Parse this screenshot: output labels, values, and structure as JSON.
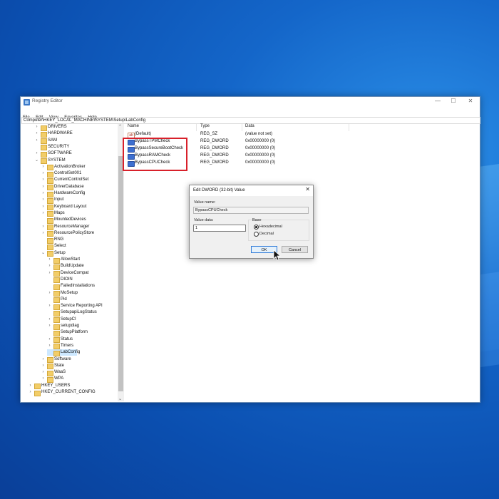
{
  "window": {
    "title": "Registry Editor",
    "controls": {
      "minimize": "—",
      "maximize": "☐",
      "close": "✕"
    }
  },
  "menu": [
    "File",
    "Edit",
    "View",
    "Favorites",
    "Help"
  ],
  "address": "Computer\\HKEY_LOCAL_MACHINE\\SYSTEM\\Setup\\LabConfig",
  "tree": {
    "items": [
      {
        "label": "DRIVERS",
        "depth": 1,
        "expander": "›"
      },
      {
        "label": "HARDWARE",
        "depth": 1,
        "expander": "›"
      },
      {
        "label": "SAM",
        "depth": 1,
        "expander": "›"
      },
      {
        "label": "SECURITY",
        "depth": 1,
        "expander": ""
      },
      {
        "label": "SOFTWARE",
        "depth": 1,
        "expander": "›"
      },
      {
        "label": "SYSTEM",
        "depth": 1,
        "expander": "⌄"
      },
      {
        "label": "ActivationBroker",
        "depth": 2,
        "expander": "›"
      },
      {
        "label": "ControlSet001",
        "depth": 2,
        "expander": "›"
      },
      {
        "label": "CurrentControlSet",
        "depth": 2,
        "expander": "›"
      },
      {
        "label": "DriverDatabase",
        "depth": 2,
        "expander": "›"
      },
      {
        "label": "HardwareConfig",
        "depth": 2,
        "expander": "›"
      },
      {
        "label": "Input",
        "depth": 2,
        "expander": "›"
      },
      {
        "label": "Keyboard Layout",
        "depth": 2,
        "expander": "›"
      },
      {
        "label": "Maps",
        "depth": 2,
        "expander": "›"
      },
      {
        "label": "MountedDevices",
        "depth": 2,
        "expander": ""
      },
      {
        "label": "ResourceManager",
        "depth": 2,
        "expander": "›"
      },
      {
        "label": "ResourcePolicyStore",
        "depth": 2,
        "expander": "›"
      },
      {
        "label": "RNG",
        "depth": 2,
        "expander": ""
      },
      {
        "label": "Select",
        "depth": 2,
        "expander": ""
      },
      {
        "label": "Setup",
        "depth": 2,
        "expander": "⌄"
      },
      {
        "label": "AllowStart",
        "depth": 3,
        "expander": "›"
      },
      {
        "label": "BuildUpdate",
        "depth": 3,
        "expander": "›"
      },
      {
        "label": "DeviceCompat",
        "depth": 3,
        "expander": "›"
      },
      {
        "label": "DIOIN",
        "depth": 3,
        "expander": ""
      },
      {
        "label": "FailedInstallations",
        "depth": 3,
        "expander": ""
      },
      {
        "label": "MoSetup",
        "depth": 3,
        "expander": "›"
      },
      {
        "label": "Pid",
        "depth": 3,
        "expander": ""
      },
      {
        "label": "Service Reporting API",
        "depth": 3,
        "expander": "›"
      },
      {
        "label": "SetupapiLogStatus",
        "depth": 3,
        "expander": ""
      },
      {
        "label": "SetupCI",
        "depth": 3,
        "expander": "›"
      },
      {
        "label": "setupdiag",
        "depth": 3,
        "expander": "›"
      },
      {
        "label": "SetupPlatform",
        "depth": 3,
        "expander": ""
      },
      {
        "label": "Status",
        "depth": 3,
        "expander": "›"
      },
      {
        "label": "Timers",
        "depth": 3,
        "expander": "›"
      },
      {
        "label": "LabConfig",
        "depth": 3,
        "expander": "",
        "selected": true
      },
      {
        "label": "Software",
        "depth": 2,
        "expander": "›"
      },
      {
        "label": "State",
        "depth": 2,
        "expander": "›"
      },
      {
        "label": "WaaS",
        "depth": 2,
        "expander": "›"
      },
      {
        "label": "WPA",
        "depth": 2,
        "expander": "›"
      },
      {
        "label": "HKEY_USERS",
        "depth": 0,
        "expander": "›"
      },
      {
        "label": "HKEY_CURRENT_CONFIG",
        "depth": 0,
        "expander": "›"
      }
    ]
  },
  "values_table": {
    "headers": [
      "Name",
      "Type",
      "Data"
    ],
    "rows": [
      {
        "name": "(Default)",
        "type": "REG_SZ",
        "data": "(value not set)",
        "icon": "ab"
      },
      {
        "name": "BypassTPMCheck",
        "type": "REG_DWORD",
        "data": "0x00000000 (0)",
        "icon": "dword"
      },
      {
        "name": "BypassSecureBootCheck",
        "type": "REG_DWORD",
        "data": "0x00000000 (0)",
        "icon": "dword"
      },
      {
        "name": "BypassRAMCheck",
        "type": "REG_DWORD",
        "data": "0x00000000 (0)",
        "icon": "dword"
      },
      {
        "name": "BypassCPUCheck",
        "type": "REG_DWORD",
        "data": "0x00000000 (0)",
        "icon": "dword"
      }
    ]
  },
  "dialog": {
    "title": "Edit DWORD (32-bit) Value",
    "close": "✕",
    "value_name_label": "Value name:",
    "value_name": "BypassCPUCheck",
    "value_data_label": "Value data:",
    "value_data": "1",
    "base_label": "Base",
    "radio_hex": "Hexadecimal",
    "radio_dec": "Decimal",
    "ok": "OK",
    "cancel": "Cancel"
  },
  "colors": {
    "highlight": "#d8202a",
    "selection": "#cde8ff",
    "ok_border": "#2f7bd8"
  }
}
